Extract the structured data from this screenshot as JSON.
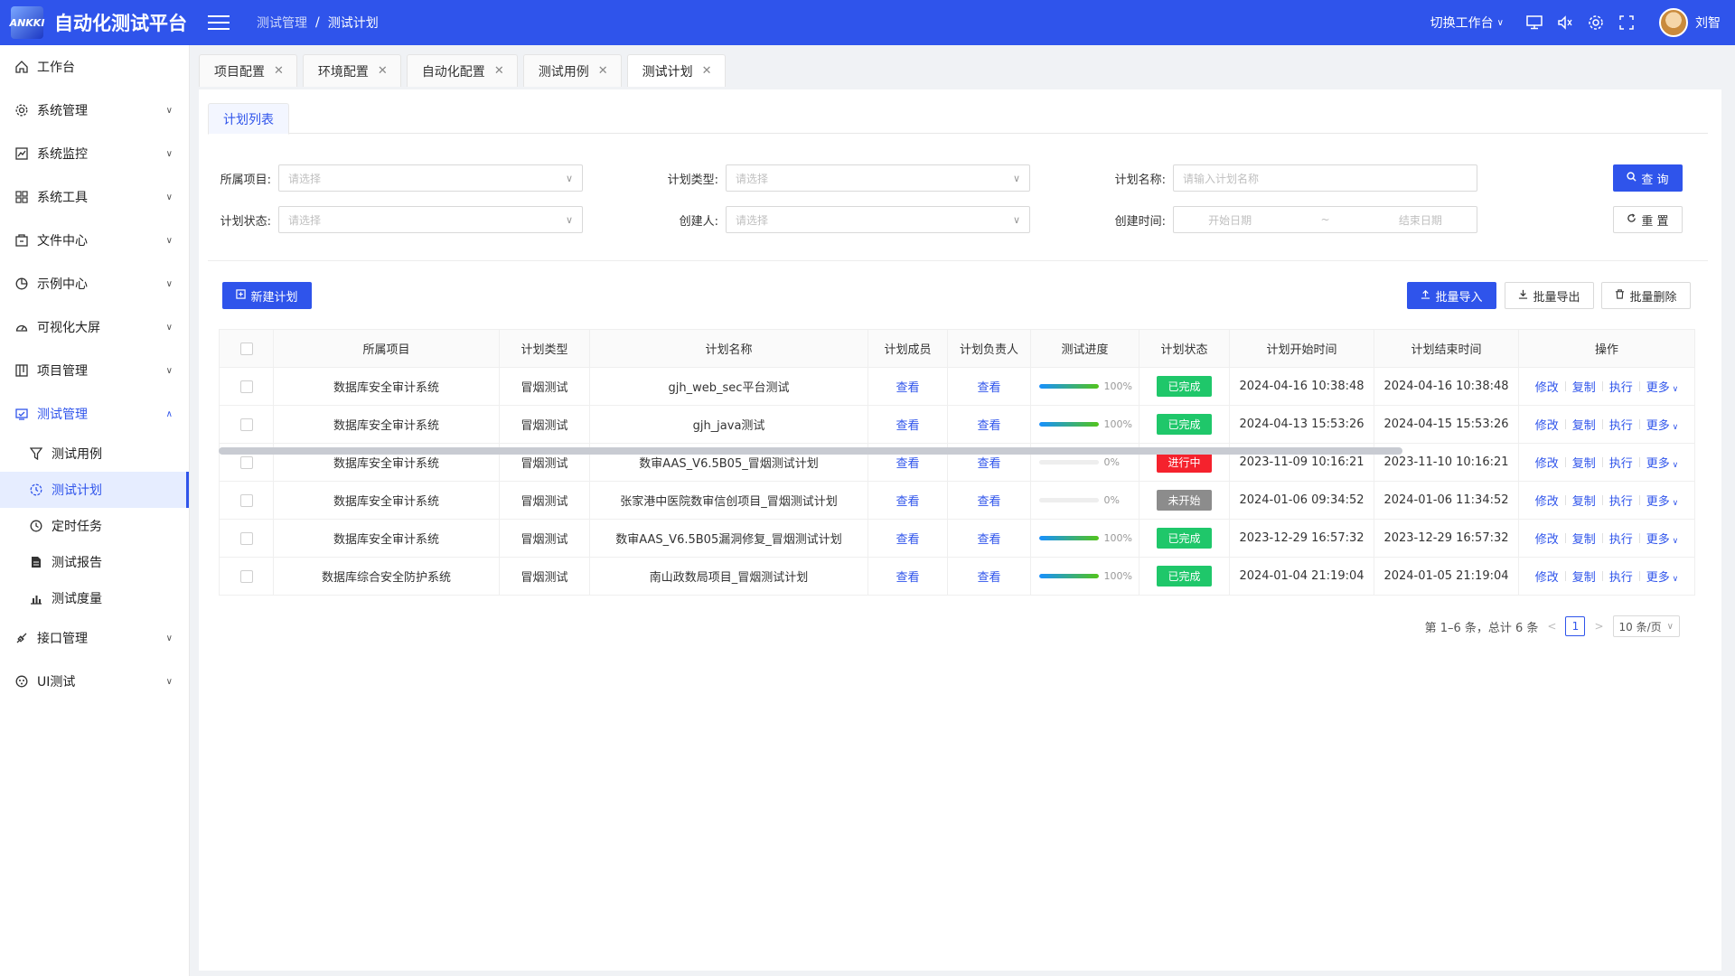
{
  "header": {
    "logo_text": "ANKKI",
    "app_title": "自动化测试平台",
    "breadcrumb": [
      "测试管理",
      "测试计划"
    ],
    "breadcrumb_sep": "/",
    "switch_workspace": "切换工作台",
    "username": "刘智",
    "icons": [
      "monitor-icon",
      "speaker-icon",
      "gear-icon",
      "fullscreen-icon"
    ]
  },
  "sidebar": {
    "items": [
      {
        "label": "工作台",
        "icon": "home-icon"
      },
      {
        "label": "系统管理",
        "icon": "gear-icon"
      },
      {
        "label": "系统监控",
        "icon": "monitor-chart-icon"
      },
      {
        "label": "系统工具",
        "icon": "grid-icon"
      },
      {
        "label": "文件中心",
        "icon": "folder-icon"
      },
      {
        "label": "示例中心",
        "icon": "pie-icon"
      },
      {
        "label": "可视化大屏",
        "icon": "dashboard-icon"
      },
      {
        "label": "项目管理",
        "icon": "project-icon"
      },
      {
        "label": "测试管理",
        "icon": "test-icon"
      }
    ],
    "sub_items": [
      {
        "label": "测试用例",
        "icon": "filter-icon"
      },
      {
        "label": "测试计划",
        "icon": "plan-icon"
      },
      {
        "label": "定时任务",
        "icon": "clock-icon"
      },
      {
        "label": "测试报告",
        "icon": "report-icon"
      },
      {
        "label": "测试度量",
        "icon": "bar-chart-icon"
      }
    ],
    "bottom_items": [
      {
        "label": "接口管理",
        "icon": "api-icon"
      },
      {
        "label": "UI测试",
        "icon": "ui-icon"
      }
    ]
  },
  "tabs": [
    {
      "label": "项目配置"
    },
    {
      "label": "环境配置"
    },
    {
      "label": "自动化配置"
    },
    {
      "label": "测试用例"
    },
    {
      "label": "测试计划"
    }
  ],
  "inner_tab": "计划列表",
  "filters": {
    "project_label": "所属项目:",
    "project_placeholder": "请选择",
    "type_label": "计划类型:",
    "type_placeholder": "请选择",
    "name_label": "计划名称:",
    "name_placeholder": "请输入计划名称",
    "status_label": "计划状态:",
    "status_placeholder": "请选择",
    "creator_label": "创建人:",
    "creator_placeholder": "请选择",
    "time_label": "创建时间:",
    "start_placeholder": "开始日期",
    "range_sep": "~",
    "end_placeholder": "结束日期",
    "search_btn": "查 询",
    "reset_btn": "重 置"
  },
  "actions": {
    "new_plan": "新建计划",
    "batch_import": "批量导入",
    "batch_export": "批量导出",
    "batch_delete": "批量删除"
  },
  "table": {
    "columns": [
      "所属项目",
      "计划类型",
      "计划名称",
      "计划成员",
      "计划负责人",
      "测试进度",
      "计划状态",
      "计划开始时间",
      "计划结束时间",
      "操作"
    ],
    "rows": [
      {
        "project": "数据库安全审计系统",
        "type": "冒烟测试",
        "name": "gjh_web_sec平台测试",
        "members": "查看",
        "owner": "查看",
        "progress": 100,
        "progress_text": "100%",
        "status": "已完成",
        "start": "2024-04-16 10:38:48",
        "end": "2024-04-16 10:38:48"
      },
      {
        "project": "数据库安全审计系统",
        "type": "冒烟测试",
        "name": "gjh_java测试",
        "members": "查看",
        "owner": "查看",
        "progress": 100,
        "progress_text": "100%",
        "status": "已完成",
        "start": "2024-04-13 15:53:26",
        "end": "2024-04-15 15:53:26"
      },
      {
        "project": "数据库安全审计系统",
        "type": "冒烟测试",
        "name": "数审AAS_V6.5B05_冒烟测试计划",
        "members": "查看",
        "owner": "查看",
        "progress": 0,
        "progress_text": "0%",
        "status": "进行中",
        "start": "2023-11-09 10:16:21",
        "end": "2023-11-10 10:16:21"
      },
      {
        "project": "数据库安全审计系统",
        "type": "冒烟测试",
        "name": "张家港中医院数审信创项目_冒烟测试计划",
        "members": "查看",
        "owner": "查看",
        "progress": 0,
        "progress_text": "0%",
        "status": "未开始",
        "start": "2024-01-06 09:34:52",
        "end": "2024-01-06 11:34:52"
      },
      {
        "project": "数据库安全审计系统",
        "type": "冒烟测试",
        "name": "数审AAS_V6.5B05漏洞修复_冒烟测试计划",
        "members": "查看",
        "owner": "查看",
        "progress": 100,
        "progress_text": "100%",
        "status": "已完成",
        "start": "2023-12-29 16:57:32",
        "end": "2023-12-29 16:57:32"
      },
      {
        "project": "数据库综合安全防护系统",
        "type": "冒烟测试",
        "name": "南山政数局项目_冒烟测试计划",
        "members": "查看",
        "owner": "查看",
        "progress": 100,
        "progress_text": "100%",
        "status": "已完成",
        "start": "2024-01-04 21:19:04",
        "end": "2024-01-05 21:19:04"
      }
    ],
    "ops": {
      "edit": "修改",
      "copy": "复制",
      "run": "执行",
      "more": "更多"
    }
  },
  "status_colors": {
    "已完成": "#1fc76a",
    "进行中": "#f5222d",
    "未开始": "#8c8c8c"
  },
  "pagination": {
    "summary": "第 1–6 条，总计 6 条",
    "current": "1",
    "page_size": "10 条/页"
  },
  "colors": {
    "primary": "#2f54eb"
  }
}
